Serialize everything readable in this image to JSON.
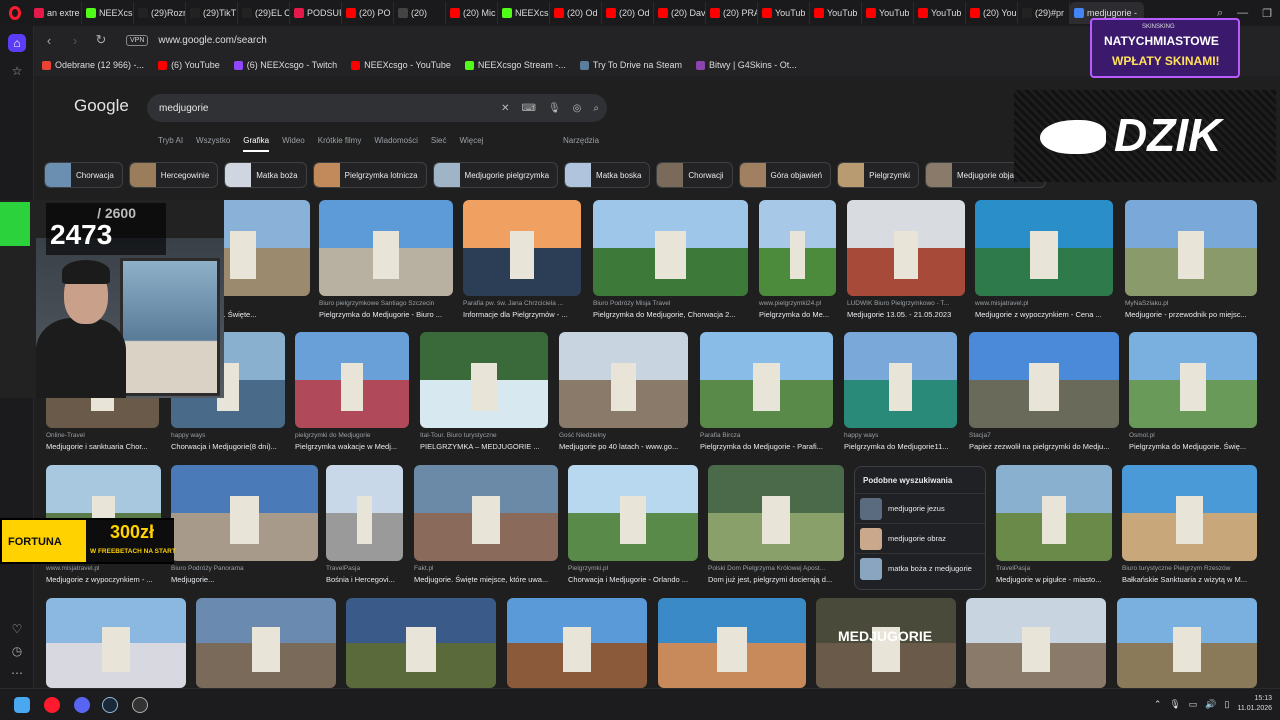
{
  "browser": {
    "tabs": [
      {
        "label": "an extre",
        "color": "#e6194b"
      },
      {
        "label": "NEEXcs",
        "color": "#53fc18"
      },
      {
        "label": "(29)Rozr",
        "color": "#222"
      },
      {
        "label": "(29)TikT",
        "color": "#222"
      },
      {
        "label": "(29)EL C",
        "color": "#222"
      },
      {
        "label": "PODSUI",
        "color": "#e6194b"
      },
      {
        "label": "(20) PO",
        "color": "#ff0000"
      },
      {
        "label": "(20)",
        "color": "#444"
      },
      {
        "label": "(20) Mic",
        "color": "#ff0000"
      },
      {
        "label": "NEEXcs",
        "color": "#53fc18"
      },
      {
        "label": "(20) Od",
        "color": "#ff0000"
      },
      {
        "label": "(20) Od",
        "color": "#ff0000"
      },
      {
        "label": "(20) Dav",
        "color": "#ff0000"
      },
      {
        "label": "(20) PRA",
        "color": "#ff0000"
      },
      {
        "label": "YouTub",
        "color": "#ff0000"
      },
      {
        "label": "YouTub",
        "color": "#ff0000"
      },
      {
        "label": "YouTub",
        "color": "#ff0000"
      },
      {
        "label": "YouTub",
        "color": "#ff0000"
      },
      {
        "label": "(20) You",
        "color": "#ff0000"
      },
      {
        "label": "(29)#pr",
        "color": "#222"
      },
      {
        "label": "medjugorie -",
        "color": "#4285f4",
        "active": true
      }
    ],
    "url": "www.google.com/search",
    "vpn_label": "VPN",
    "bookmarks": [
      {
        "label": "Odebrane (12 966) -...",
        "color": "#ea4335"
      },
      {
        "label": "(6) YouTube",
        "color": "#ff0000"
      },
      {
        "label": "(6) NEEXcsgo - Twitch",
        "color": "#9146ff"
      },
      {
        "label": "NEEXcsgo - YouTube",
        "color": "#ff0000"
      },
      {
        "label": "NEEXcsgo Stream -...",
        "color": "#53fc18"
      },
      {
        "label": "Try To Drive na Steam",
        "color": "#5c7e9a"
      },
      {
        "label": "Bitwy | G4Skins - Ot...",
        "color": "#8e44ad"
      }
    ]
  },
  "google": {
    "logo": "Google",
    "query": "medjugorie",
    "nav_tabs": [
      "Tryb AI",
      "Wszystko",
      "Grafika",
      "Wideo",
      "Krótkie filmy",
      "Wiadomości",
      "Sieć",
      "Więcej"
    ],
    "active_tab": "Grafika",
    "tools": "Narzędzia",
    "chips": [
      {
        "label": "Chorwacja",
        "color": "#6b8fb0"
      },
      {
        "label": "Hercegowinie",
        "color": "#9a7d5b"
      },
      {
        "label": "Matka boża",
        "color": "#cfd6e0"
      },
      {
        "label": "Pielgrzymka lotnicza",
        "color": "#c28a5a"
      },
      {
        "label": "Medjugorie pielgrzymka",
        "color": "#a0b4c8"
      },
      {
        "label": "Matka boska",
        "color": "#b0c4de"
      },
      {
        "label": "Chorwacji",
        "color": "#7a6a5a"
      },
      {
        "label": "Góra objawień",
        "color": "#a08060"
      },
      {
        "label": "Pielgrzymki",
        "color": "#b89b70"
      },
      {
        "label": "Medjugorie objawienia",
        "color": "#8a7a6a"
      }
    ],
    "related": {
      "heading": "Podobne wyszukiwania",
      "items": [
        {
          "label": "medjugorie jezus",
          "color": "#5a6b80"
        },
        {
          "label": "medjugorie obraz",
          "color": "#c9a88c"
        },
        {
          "label": "matka boża z medjugorie",
          "color": "#8aa5c0"
        }
      ]
    },
    "row1": [
      {
        "source": "",
        "title": "",
        "sky": "#6fa4d9",
        "ground": "#6a6a58"
      },
      {
        "source": "",
        "title": "do Medjugorie. Święte...",
        "sky": "#8ab2d8",
        "ground": "#9c8a6e"
      },
      {
        "source": "Biuro pielgrzymkowe Santiago Szczecin",
        "title": "Pielgrzymka do Medjugorie - Biuro ...",
        "sky": "#5d9ad8",
        "ground": "#b8b0a0"
      },
      {
        "source": "Parafia pw. św. Jana Chrzciciela ...",
        "title": "Informacje dla Pielgrzymów - ...",
        "sky": "#f0a060",
        "ground": "#2c3e55"
      },
      {
        "source": "Biuro Podróży Misja Travel",
        "title": "Pielgrzymka do Medjugorie, Chorwacja 2...",
        "sky": "#9ec6e8",
        "ground": "#3d7a3a"
      },
      {
        "source": "www.pielgrzymki24.pl",
        "title": "Pielgrzymka do Me...",
        "sky": "#a8c8e8",
        "ground": "#4c8a3c"
      },
      {
        "source": "LUDWIK Biuro Pielgrzymkowo - T...",
        "title": "Medjugorie 13.05. - 21.05.2023",
        "sky": "#d8dce0",
        "ground": "#a84a3a"
      },
      {
        "source": "www.misjatravel.pl",
        "title": "Medjugorie z wypoczynkiem - Cena ...",
        "sky": "#2a8ec8",
        "ground": "#2e7a4a"
      },
      {
        "source": "MyNaSzlaku.pl",
        "title": "Medjugorie - przewodnik po miejsc...",
        "sky": "#7aa8d8",
        "ground": "#8a9a6a"
      }
    ],
    "row2": [
      {
        "source": "Online-Travel",
        "title": "Medjugorie i sanktuaria Chor...",
        "sky": "#9ab8d8",
        "ground": "#6a5a4a"
      },
      {
        "source": "happy ways",
        "title": "Chorwacja i Medjugorie(8 dni)...",
        "sky": "#8ab0d0",
        "ground": "#4a6a8a"
      },
      {
        "source": "pielgrzymki do Medjugorie",
        "title": "Pielgrzymka wakacje w Medj...",
        "sky": "#6aa0d8",
        "ground": "#b04a5a"
      },
      {
        "source": "Ital-Tour. Biuro turystyczne",
        "title": "PIELGRZYMKA – MEDJUGORIE ...",
        "sky": "#3a6a3a",
        "ground": "#d8e8f0"
      },
      {
        "source": "Gość Niedzielny",
        "title": "Medjugorie po 40 latach - www.go...",
        "sky": "#c8d4e0",
        "ground": "#8a7a6a"
      },
      {
        "source": "Parafia Bircza",
        "title": "Pielgrzymka do Medjugorie - Parafi...",
        "sky": "#8abce8",
        "ground": "#5a8a4a"
      },
      {
        "source": "happy ways",
        "title": "Pielgrzymka do Medjugorie11...",
        "sky": "#7aa8d8",
        "ground": "#2a8a7a"
      },
      {
        "source": "Stacja7",
        "title": "Papież zezwolił na pielgrzymki do Medju...",
        "sky": "#4a8ad8",
        "ground": "#6a6a5a"
      },
      {
        "source": "Osmol.pl",
        "title": "Pielgrzymka do Medjugorie. Świę...",
        "sky": "#7ab0e0",
        "ground": "#6a9a5a"
      }
    ],
    "row3": [
      {
        "source": "www.misjatravel.pl",
        "title": "Medjugorie z wypoczynkiem - ...",
        "sky": "#a8c8e0",
        "ground": "#5a7a4a"
      },
      {
        "source": "Biuro Podróży Panorama",
        "title": "Medjugorie...",
        "sky": "#4a7ab8",
        "ground": "#a89a8a"
      },
      {
        "source": "TravelPasja",
        "title": "Bośnia i Hercegovi...",
        "sky": "#c8d8e8",
        "ground": "#9a9a9a"
      },
      {
        "source": "Fakt.pl",
        "title": "Medjugorie. Święte miejsce, które uwa...",
        "sky": "#6a8aa8",
        "ground": "#8a6a5a"
      },
      {
        "source": "Pielgrzymki.pl",
        "title": "Chorwacja i Medjugorie - Orlando ...",
        "sky": "#b8d8f0",
        "ground": "#5a8a4a"
      },
      {
        "source": "Polski Dom Pielgrzyma Królowej Apost...",
        "title": "Dom już jest, pielgrzymi docierają d...",
        "sky": "#4a6a4a",
        "ground": "#8aa06a"
      },
      {
        "source": "TravelPasja",
        "title": "Medjugorie w pigułce - miasto...",
        "sky": "#8ab0d0",
        "ground": "#6a8a4a"
      },
      {
        "source": "Biuro turystyczne Pielgrzym Rzeszów",
        "title": "Bałkańskie Sanktuaria z wizytą w M...",
        "sky": "#4a9ad8",
        "ground": "#c8a87a"
      }
    ],
    "row4": [
      {
        "sky": "#8ab8e0",
        "ground": "#d8d8e0",
        "title": ""
      },
      {
        "sky": "#6a8ab0",
        "ground": "#7a6a5a",
        "title": ""
      },
      {
        "sky": "#3a5a8a",
        "ground": "#5a6a3a",
        "title": ""
      },
      {
        "sky": "#5a9ad8",
        "ground": "#8a5a3a",
        "title": ""
      },
      {
        "sky": "#3a8ac8",
        "ground": "#c88a5a",
        "title": ""
      },
      {
        "sky": "#4a4a3a",
        "ground": "#6a5a4a",
        "title": "MEDJUGORIE"
      },
      {
        "sky": "#c8d4e0",
        "ground": "#8a7a6a",
        "title": ""
      },
      {
        "sky": "#7ab0e0",
        "ground": "#8a7a5a",
        "title": ""
      }
    ]
  },
  "overlays": {
    "counter_total": "/ 2600",
    "counter_value": "2473",
    "fortuna_name": "FORTUNA",
    "fortuna_amount": "300zł",
    "fortuna_desc": "W FREEBETACH NA START",
    "skin_brand": "SKINSKING",
    "skin_line1": "NATYCHMIASTOWE",
    "skin_line2": "WPŁATY SKINAMI!",
    "dzik_text": "DZIK"
  },
  "taskbar": {
    "time": "15:13",
    "date": "11.01.2026"
  }
}
